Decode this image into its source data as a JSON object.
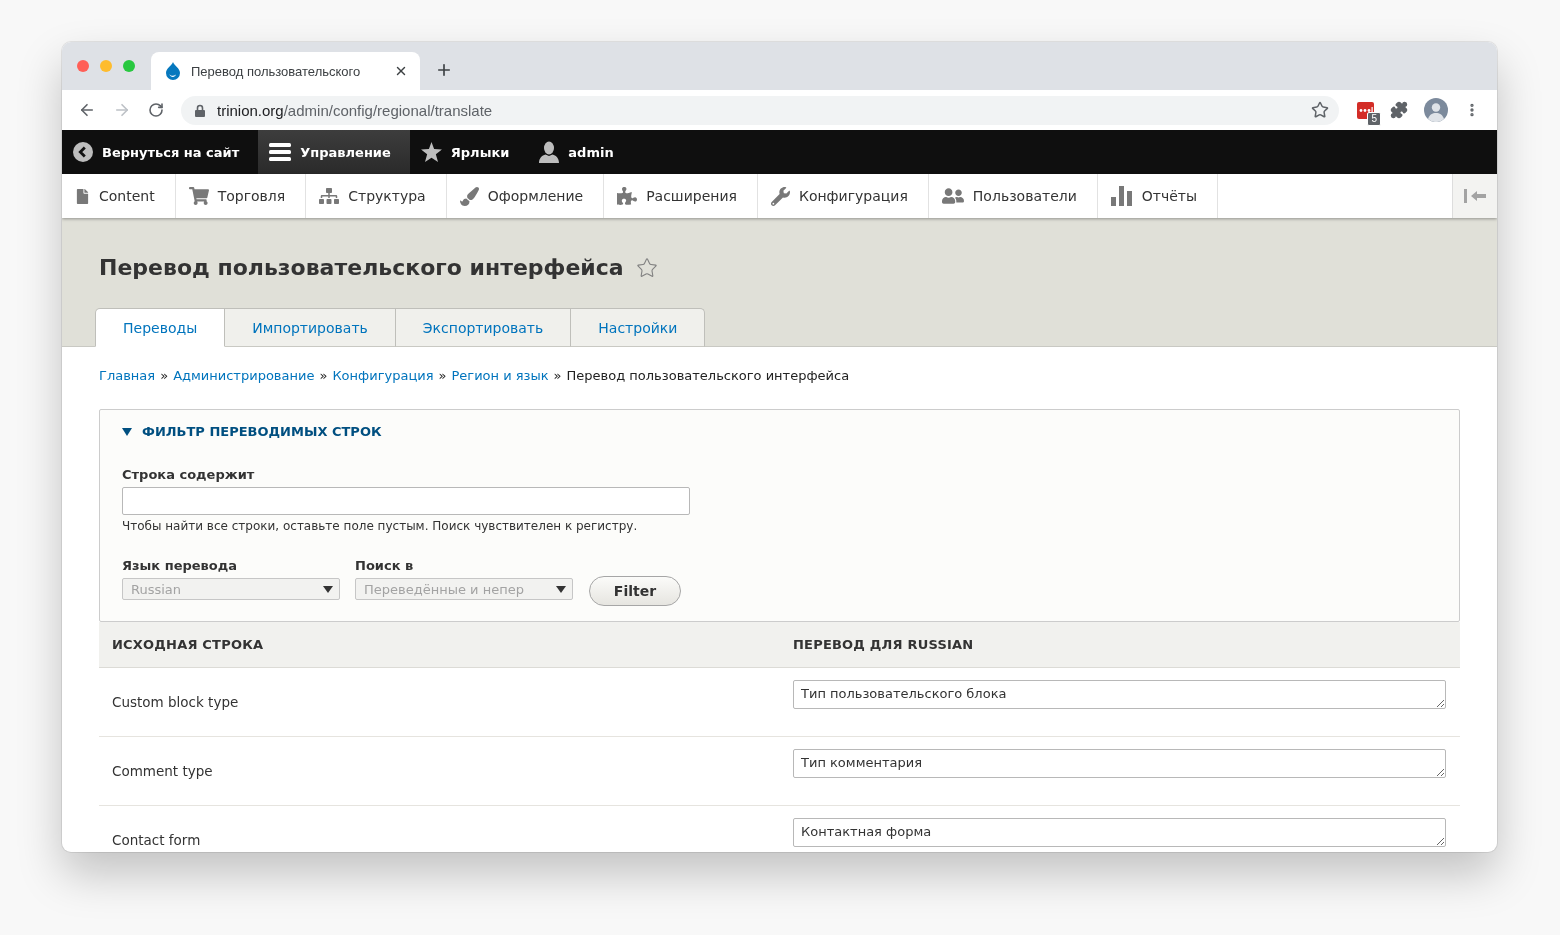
{
  "browser": {
    "tab_title": "Перевод пользовательского",
    "url_host": "trinion.org",
    "url_path": "/admin/config/regional/translate",
    "extension_badge": "5"
  },
  "toolbar": [
    {
      "label": "Вернуться на сайт",
      "selected": false
    },
    {
      "label": "Управление",
      "selected": true
    },
    {
      "label": "Ярлыки",
      "selected": false
    },
    {
      "label": "admin",
      "selected": false
    }
  ],
  "menu": [
    {
      "label": "Content"
    },
    {
      "label": "Торговля"
    },
    {
      "label": "Структура"
    },
    {
      "label": "Оформление"
    },
    {
      "label": "Расширения"
    },
    {
      "label": "Конфигурация"
    },
    {
      "label": "Пользователи"
    },
    {
      "label": "Отчёты"
    }
  ],
  "page_title": "Перевод пользовательского интерфейса",
  "tabs": [
    {
      "label": "Переводы",
      "selected": true
    },
    {
      "label": "Импортировать",
      "selected": false
    },
    {
      "label": "Экспортировать",
      "selected": false
    },
    {
      "label": "Настройки",
      "selected": false
    }
  ],
  "breadcrumb": [
    {
      "label": "Главная",
      "current": false,
      "separator": "»"
    },
    {
      "label": "Администрирование",
      "current": false,
      "separator": "»"
    },
    {
      "label": "Конфигурация",
      "current": false,
      "separator": "»"
    },
    {
      "label": "Регион и язык",
      "current": false,
      "separator": "»"
    },
    {
      "label": "Перевод пользовательского интерфейса",
      "current": true
    }
  ],
  "filter": {
    "summary": "ФИЛЬТР ПЕРЕВОДИМЫХ СТРОК",
    "expanded": true,
    "search": {
      "label": "Строка содержит",
      "description": "Чтобы найти все строки, оставьте поле пустым. Поиск чувствителен к регистру."
    },
    "selects": [
      {
        "label": "Язык перевода",
        "value": "Russian"
      },
      {
        "label": "Поиск в",
        "value": "Переведённые и непер"
      }
    ],
    "button": "Filter"
  },
  "table": {
    "columns": [
      "ИСХОДНАЯ СТРОКА",
      "ПЕРЕВОД ДЛЯ RUSSIAN"
    ],
    "rows": [
      {
        "source": "Custom block type",
        "translation": "Тип пользовательского блока"
      },
      {
        "source": "Comment type",
        "translation": "Тип комментария"
      },
      {
        "source": "Contact form",
        "translation": "Контактная форма"
      }
    ]
  }
}
